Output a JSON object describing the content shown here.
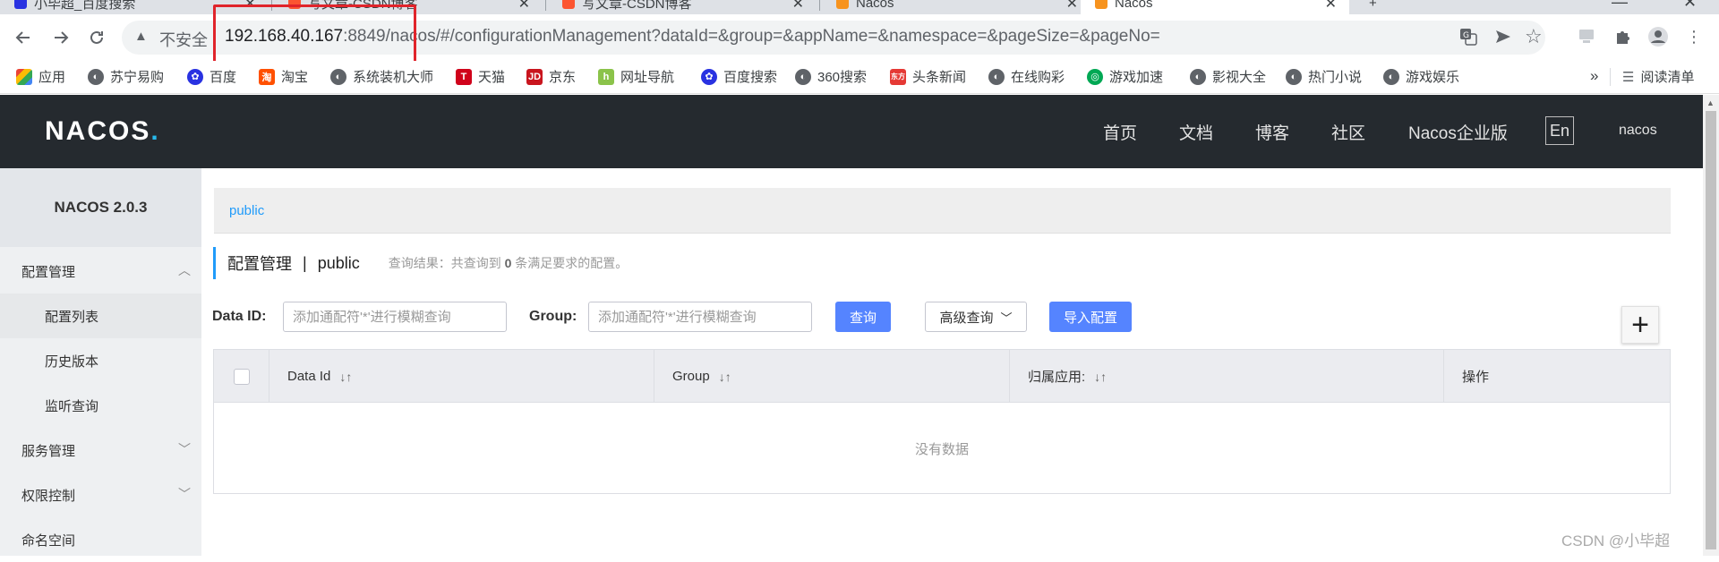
{
  "browser": {
    "tabs": [
      {
        "title": "小毕超_百度搜索"
      },
      {
        "title": "写文章-CSDN博客"
      },
      {
        "title": "写文章-CSDN博客"
      },
      {
        "title": "Nacos"
      },
      {
        "title": "Nacos"
      }
    ],
    "new_tab": "+",
    "address": {
      "security_label": "不安全",
      "url_host": "192.168.40.167",
      "url_rest": ":8849/nacos/#/configurationManagement?dataId=&group=&appName=&namespace=&pageSize=&pageNo="
    },
    "bookmarks": [
      {
        "label": "应用",
        "icon": "apps-grid-icon",
        "color": "#ea4335"
      },
      {
        "label": "苏宁易购",
        "icon": "globe-icon",
        "color": "#5f6368"
      },
      {
        "label": "百度",
        "icon": "baidu-paw-icon",
        "color": "#2932e1"
      },
      {
        "label": "淘宝",
        "icon": "taobao-icon",
        "color": "#ff5000"
      },
      {
        "label": "系统装机大师",
        "icon": "globe-icon",
        "color": "#5f6368"
      },
      {
        "label": "天猫",
        "icon": "tmall-icon",
        "color": "#d0021b"
      },
      {
        "label": "京东",
        "icon": "jd-icon",
        "color": "#c9151e"
      },
      {
        "label": "网址导航",
        "icon": "hao-icon",
        "color": "#4caf50"
      },
      {
        "label": "百度搜索",
        "icon": "baidu-paw-icon",
        "color": "#2932e1"
      },
      {
        "label": "360搜索",
        "icon": "globe-icon",
        "color": "#5f6368"
      },
      {
        "label": "头条新闻",
        "icon": "dongfang-icon",
        "color": "#e53935"
      },
      {
        "label": "在线购彩",
        "icon": "globe-icon",
        "color": "#5f6368"
      },
      {
        "label": "游戏加速",
        "icon": "game-speed-icon",
        "color": "#00a854"
      },
      {
        "label": "影视大全",
        "icon": "globe-icon",
        "color": "#5f6368"
      },
      {
        "label": "热门小说",
        "icon": "globe-icon",
        "color": "#5f6368"
      },
      {
        "label": "游戏娱乐",
        "icon": "globe-icon",
        "color": "#5f6368"
      }
    ],
    "overflow": "»",
    "reading_list": "阅读清单"
  },
  "nacos": {
    "logo": "NACOS",
    "logo_dot": ".",
    "nav": [
      {
        "label": "首页"
      },
      {
        "label": "文档"
      },
      {
        "label": "博客"
      },
      {
        "label": "社区"
      },
      {
        "label": "Nacos企业版"
      }
    ],
    "lang": "En",
    "user": "nacos"
  },
  "sidebar": {
    "title": "NACOS 2.0.3",
    "items": [
      {
        "label": "配置管理",
        "type": "group",
        "expanded": true
      },
      {
        "label": "配置列表",
        "type": "sub",
        "active": true
      },
      {
        "label": "历史版本",
        "type": "sub"
      },
      {
        "label": "监听查询",
        "type": "sub"
      },
      {
        "label": "服务管理",
        "type": "group"
      },
      {
        "label": "权限控制",
        "type": "group"
      },
      {
        "label": "命名空间",
        "type": "group"
      }
    ]
  },
  "main": {
    "namespace_tab": "public",
    "page_title": "配置管理",
    "title_sep": "|",
    "namespace": "public",
    "result_prefix": "查询结果：共查询到",
    "result_count": "0",
    "result_suffix": "条满足要求的配置。",
    "filters": {
      "dataid_label": "Data ID:",
      "dataid_placeholder": "添加通配符'*'进行模糊查询",
      "group_label": "Group:",
      "group_placeholder": "添加通配符'*'进行模糊查询",
      "query_button": "查询",
      "advanced_button": "高级查询",
      "import_button": "导入配置",
      "add_button": "+"
    },
    "table": {
      "columns": [
        "Data Id",
        "Group",
        "归属应用:",
        "操作"
      ],
      "empty_text": "没有数据"
    }
  },
  "watermark": "CSDN @小毕超",
  "colors": {
    "header_bg": "#252a2f",
    "accent_blue": "#209bfa",
    "primary_button": "#5584ff",
    "highlight_box": "#e0242b"
  }
}
